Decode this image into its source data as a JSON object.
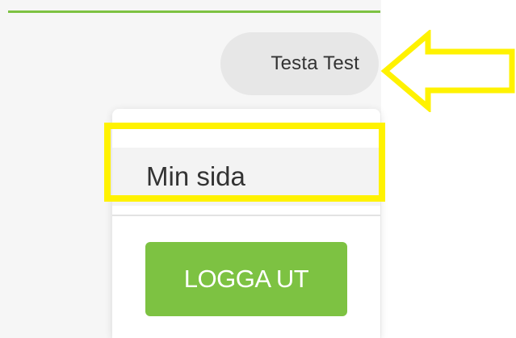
{
  "header": {
    "user_name": "Testa Test"
  },
  "dropdown": {
    "my_page_label": "Min sida",
    "logout_label": "LOGGA UT"
  },
  "annotations": {
    "highlight_color": "#fff200",
    "arrow_icon": "left-arrow-outline-icon"
  },
  "colors": {
    "accent": "#7dc242"
  }
}
